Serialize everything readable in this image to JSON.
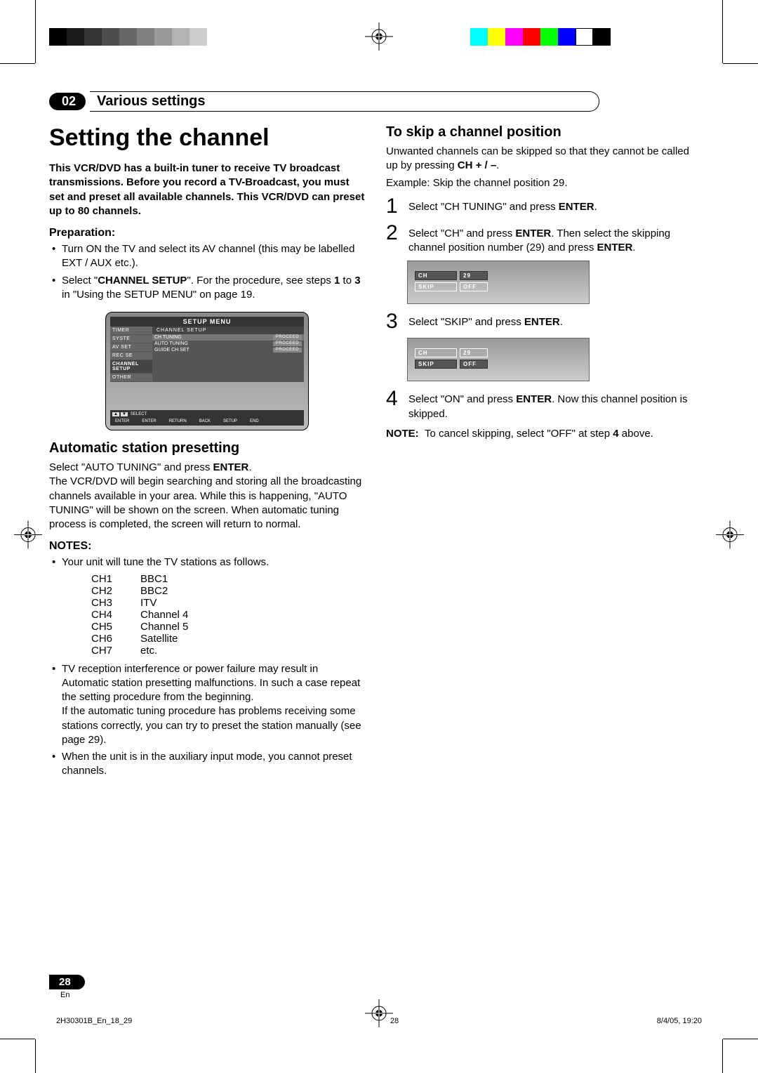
{
  "chapter": {
    "number": "02",
    "title": "Various settings"
  },
  "heading": "Setting the channel",
  "intro": "This VCR/DVD has a built-in tuner to receive TV broadcast transmissions. Before you record a TV-Broadcast, you must set and preset all available channels. This VCR/DVD can preset up to 80 channels.",
  "prep_heading": "Preparation:",
  "prep_items": [
    "Turn ON the TV and select its AV channel (this may be labelled EXT / AUX etc.).",
    "Select \"CHANNEL SETUP\". For the procedure, see steps 1 to 3 in \"Using the SETUP MENU\" on page 19."
  ],
  "setup_menu": {
    "title": "SETUP MENU",
    "left_items": [
      "TIMER",
      "SYSTE",
      "AV SET",
      "REC SE",
      "CHANNEL SETUP",
      "OTHER"
    ],
    "right_header": "CHANNEL SETUP",
    "right_rows": [
      {
        "k": "CH TUNING",
        "v": "PROCEED"
      },
      {
        "k": "AUTO TUNING",
        "v": "PROCEED"
      },
      {
        "k": "GUIDE CH SET",
        "v": "PROCEED"
      }
    ],
    "footer1": {
      "arrows": "▲ ▼",
      "label": "SELECT"
    },
    "footer2": [
      "ENTER",
      "ENTER",
      "RETURN",
      "BACK",
      "SETUP",
      "END"
    ]
  },
  "auto_heading": "Automatic station presetting",
  "auto_body": "Select \"AUTO TUNING\" and press ENTER.\nThe VCR/DVD will begin searching and storing all the broadcasting channels available in your area. While this is happening, \"AUTO TUNING\" will be shown on the screen. When automatic tuning process is completed, the screen will return to normal.",
  "notes_heading": "NOTES:",
  "notes_intro": "Your unit will tune the TV stations as follows.",
  "ch_table": [
    [
      "CH1",
      "BBC1"
    ],
    [
      "CH2",
      "BBC2"
    ],
    [
      "CH3",
      "ITV"
    ],
    [
      "CH4",
      "Channel 4"
    ],
    [
      "CH5",
      "Channel 5"
    ],
    [
      "CH6",
      "Satellite"
    ],
    [
      "CH7",
      "etc."
    ]
  ],
  "notes_rest": [
    "TV reception interference or power failure may result in Automatic station presetting malfunctions. In such a case repeat the setting procedure from the beginning.\nIf the automatic tuning procedure has problems receiving some stations correctly, you can try to preset the station manually (see page 29).",
    "When the unit is in the auxiliary input mode, you cannot preset channels."
  ],
  "skip_heading": "To skip a channel position",
  "skip_intro": "Unwanted channels can be skipped so that they cannot be called up by pressing CH + / –.",
  "skip_example": "Example: Skip the channel position 29.",
  "steps": [
    {
      "n": "1",
      "t": "Select \"CH TUNING\" and press ENTER."
    },
    {
      "n": "2",
      "t": "Select \"CH\" and press ENTER. Then select the skipping channel position number (29) and press ENTER."
    },
    {
      "n": "3",
      "t": "Select \"SKIP\" and press ENTER."
    },
    {
      "n": "4",
      "t": "Select \"ON\" and press ENTER. Now this channel position is skipped."
    }
  ],
  "osd1": {
    "rows": [
      {
        "k": "CH",
        "v": "29",
        "hl": true
      },
      {
        "k": "SKIP",
        "v": "OFF",
        "hl": false
      }
    ]
  },
  "osd2": {
    "rows": [
      {
        "k": "CH",
        "v": "29",
        "hl": false
      },
      {
        "k": "SKIP",
        "v": "OFF",
        "hl": true
      }
    ]
  },
  "skip_note": "NOTE:  To cancel skipping, select \"OFF\" at step 4 above.",
  "page_number": "28",
  "page_lang": "En",
  "footer": {
    "docid": "2H30301B_En_18_29",
    "page": "28",
    "timestamp": "8/4/05, 19:20"
  }
}
